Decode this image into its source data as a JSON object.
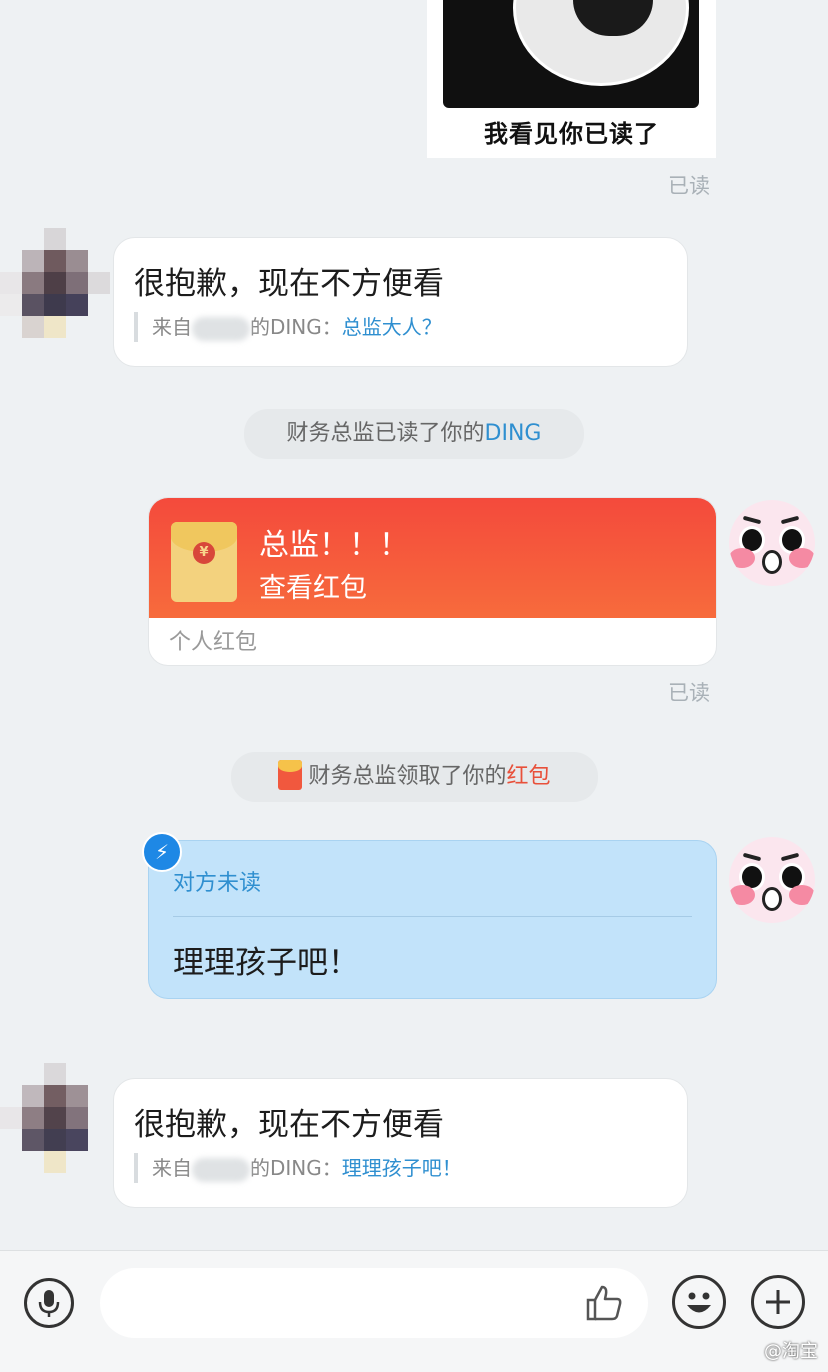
{
  "meme": {
    "caption": "我看见你已读了"
  },
  "read_labels": {
    "first": "已读",
    "second": "已读"
  },
  "ding_message_1": {
    "main": "很抱歉，现在不方便看",
    "prefix": "来自",
    "suffix": "的DING：",
    "quoted": "总监大人？"
  },
  "notice_1": {
    "text": "财务总监已读了你的",
    "highlight": "DING"
  },
  "red_packet": {
    "title": "总监！！！",
    "action": "查看红包",
    "type_label": "个人红包"
  },
  "notice_2": {
    "text": "财务总监领取了你的",
    "highlight": "红包"
  },
  "ding_card": {
    "status": "对方未读",
    "message": "理理孩子吧！"
  },
  "ding_message_2": {
    "main": "很抱歉，现在不方便看",
    "prefix": "来自",
    "suffix": "的DING：",
    "quoted": "理理孩子吧！"
  },
  "input_bar": {
    "placeholder": "",
    "icons": [
      "microphone-icon",
      "thumbs-up-icon",
      "emoji-icon",
      "plus-icon"
    ]
  },
  "watermark": {
    "text": "@淘宝"
  },
  "colors": {
    "background": "#eef1f3",
    "link_blue": "#2f8fd0",
    "red_packet": "#f44a3c",
    "ding_card_bg": "#c2e3fa"
  }
}
